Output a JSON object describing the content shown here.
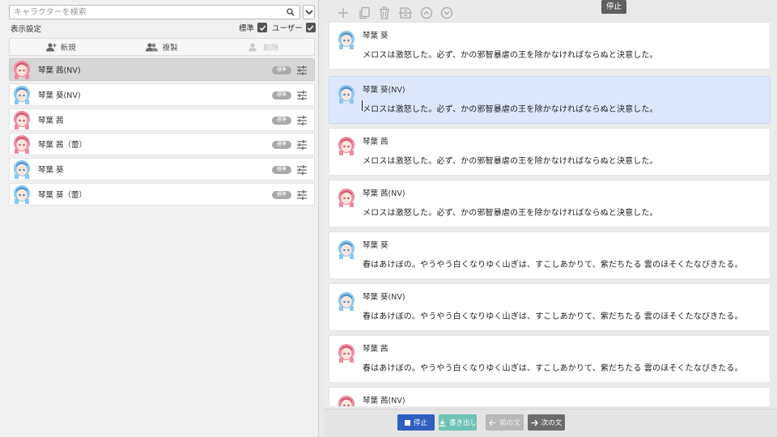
{
  "search": {
    "placeholder": "キャラクターを検索"
  },
  "display": {
    "label": "表示設定",
    "filters": [
      {
        "label": "標準",
        "checked": true
      },
      {
        "label": "ユーザー",
        "checked": true
      }
    ]
  },
  "actions": {
    "new": "新規",
    "duplicate": "複製",
    "delete": "削除"
  },
  "characters": [
    {
      "name": "琴葉 茜(NV)",
      "tag": "標準",
      "selected": true,
      "hair": "pink"
    },
    {
      "name": "琴葉 葵(NV)",
      "tag": "標準",
      "selected": false,
      "hair": "blue"
    },
    {
      "name": "琴葉 茜",
      "tag": "標準",
      "selected": false,
      "hair": "pink"
    },
    {
      "name": "琴葉 茜（蕾）",
      "tag": "標準",
      "selected": false,
      "hair": "pink"
    },
    {
      "name": "琴葉 葵",
      "tag": "標準",
      "selected": false,
      "hair": "blue"
    },
    {
      "name": "琴葉 葵（蕾）",
      "tag": "標準",
      "selected": false,
      "hair": "blue"
    }
  ],
  "toolbar": {
    "icons": [
      "add-icon",
      "copy-icon",
      "delete-icon",
      "split-icon",
      "move-up-icon",
      "move-down-icon"
    ],
    "tooltip": "停止"
  },
  "lines": [
    {
      "speaker": "琴葉 葵",
      "text": "メロスは激怒した。必ず、かの邪智暴虐の王を除かなければならぬと決意した。",
      "hair": "blue",
      "active": false
    },
    {
      "speaker": "琴葉 葵(NV)",
      "text": "メロスは激怒した。必ず、かの邪智暴虐の王を除かなければならぬと決意した。",
      "hair": "blue",
      "active": true
    },
    {
      "speaker": "琴葉 茜",
      "text": "メロスは激怒した。必ず、かの邪智暴虐の王を除かなければならぬと決意した。",
      "hair": "pink",
      "active": false
    },
    {
      "speaker": "琴葉 茜(NV)",
      "text": "メロスは激怒した。必ず、かの邪智暴虐の王を除かなければならぬと決意した。",
      "hair": "pink",
      "active": false
    },
    {
      "speaker": "琴葉 葵",
      "text": "春はあけぼの。やうやう白くなりゆく山ぎは、すこしあかりて、紫だちたる 雲のほそくたなびきたる。",
      "hair": "blue",
      "active": false
    },
    {
      "speaker": "琴葉 葵(NV)",
      "text": "春はあけぼの。やうやう白くなりゆく山ぎは、すこしあかりて、紫だちたる 雲のほそくたなびきたる。",
      "hair": "blue",
      "active": false
    },
    {
      "speaker": "琴葉 茜",
      "text": "春はあけぼの。やうやう白くなりゆく山ぎは、すこしあかりて、紫だちたる 雲のほそくたなびきたる。",
      "hair": "pink",
      "active": false
    },
    {
      "speaker": "琴葉 茜(NV)",
      "text": "",
      "hair": "pink",
      "active": false
    }
  ],
  "bottom": {
    "stop": "停止",
    "export": "書き出し",
    "prev": "前の文",
    "next": "次の文"
  },
  "colors": {
    "accent": "#2f5fc0",
    "active_line": "#dde7fb",
    "export": "#6fc2b6",
    "pink_hair": "#ef8a9d",
    "blue_hair": "#8cc6ee"
  }
}
